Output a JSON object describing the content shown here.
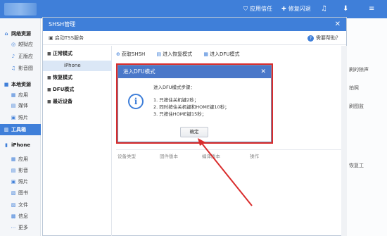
{
  "topbar": {
    "items": [
      {
        "icon": "shield-icon",
        "label": "应用信任"
      },
      {
        "icon": "wrench-icon",
        "label": "修复闪退"
      },
      {
        "icon": "music-icon",
        "label": ""
      },
      {
        "icon": "download-icon",
        "label": ""
      },
      {
        "icon": "menu-icon",
        "label": ""
      }
    ]
  },
  "sidebar": {
    "items": [
      {
        "label": "网络资源",
        "kind": "head",
        "icon": "⌂"
      },
      {
        "label": "越狱应",
        "kind": "sub",
        "icon": "◎"
      },
      {
        "label": "正版应",
        "kind": "sub",
        "icon": "♪"
      },
      {
        "label": "影音图",
        "kind": "sub",
        "icon": "♫"
      },
      {
        "label": "本地资源",
        "kind": "head",
        "icon": "■"
      },
      {
        "label": "应用",
        "kind": "sub",
        "icon": "▦"
      },
      {
        "label": "媒体",
        "kind": "sub",
        "icon": "▤"
      },
      {
        "label": "照片",
        "kind": "sub",
        "icon": "▣"
      },
      {
        "label": "工具箱",
        "kind": "active",
        "icon": "▥"
      },
      {
        "label": "iPhone",
        "kind": "head",
        "icon": "▮"
      },
      {
        "label": "应用",
        "kind": "sub",
        "icon": "▦"
      },
      {
        "label": "影音",
        "kind": "sub",
        "icon": "▤"
      },
      {
        "label": "照片",
        "kind": "sub",
        "icon": "▣"
      },
      {
        "label": "图书",
        "kind": "sub",
        "icon": "▧"
      },
      {
        "label": "文件",
        "kind": "sub",
        "icon": "▨"
      },
      {
        "label": "信息",
        "kind": "sub",
        "icon": "▩"
      },
      {
        "label": "更多",
        "kind": "sub",
        "icon": "⋯"
      }
    ]
  },
  "background_right": {
    "lines": [
      "刷的除声",
      "拍照",
      "刷图监",
      "恢复工"
    ]
  },
  "shsh": {
    "title": "SHSH管理",
    "tts_label": "启动TSS服务",
    "help_label": "需要帮助？",
    "tree": [
      {
        "label": "正常模式",
        "kind": "group"
      },
      {
        "label": "iPhone",
        "kind": "leaf"
      },
      {
        "label": "恢复模式",
        "kind": "group"
      },
      {
        "label": "DFU模式",
        "kind": "group"
      },
      {
        "label": "最近设备",
        "kind": "group"
      }
    ],
    "tabs": [
      "获取SHSH",
      "进入恢复模式",
      "进入DFU模式"
    ],
    "columns": [
      "设备类型",
      "固件版本",
      "编译版本",
      "操作"
    ]
  },
  "dfu_dialog": {
    "title": "进入DFU模式",
    "steps_title": "进入DFU模式步骤：",
    "steps": [
      "1. 只按住关机键2秒；",
      "2. 同时按住关机键和HOME键10秒；",
      "3. 只按住HOME键15秒；"
    ],
    "ok_label": "确定"
  },
  "colors": {
    "accent": "#3f7fd9",
    "dialog_title": "#4a78c9",
    "highlight": "#d92c2c"
  }
}
